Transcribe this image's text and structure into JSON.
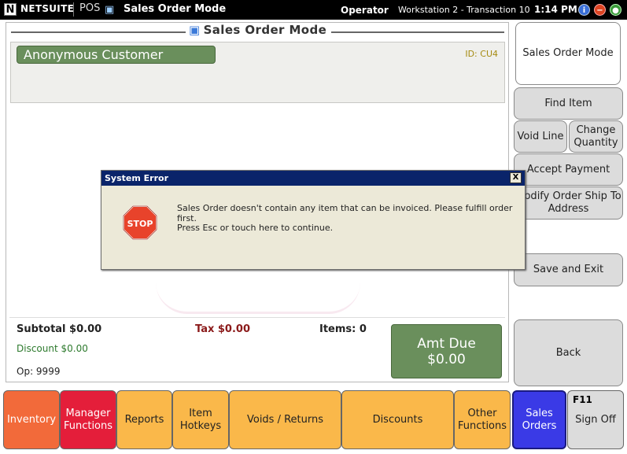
{
  "titlebar": {
    "logo_letter": "N",
    "brand": "NETSUITE",
    "product": "POS",
    "mode": "Sales Order Mode",
    "operator": "Operator",
    "workstation": "Workstation 2 - Transaction 10",
    "time": "1:14 PM",
    "icons": [
      "info-icon",
      "close-icon",
      "globe-icon"
    ]
  },
  "main": {
    "heading": "Sales Order Mode",
    "customer": {
      "name": "Anonymous Customer",
      "id": "ID: CU4"
    },
    "totals": {
      "subtotal": "Subtotal $0.00",
      "tax": "Tax $0.00",
      "items": "Items: 0",
      "discount": "Discount $0.00",
      "op": "Op: 9999",
      "amt_due_label": "Amt Due",
      "amt_due_value": "$0.00"
    }
  },
  "side": {
    "sales_order_mode": "Sales Order Mode",
    "find_item": "Find Item",
    "void_line": "Void Line",
    "change_quantity": "Change Quantity",
    "accept_payment": "Accept Payment",
    "modify_ship": "Modify Order Ship To Address",
    "save_exit": "Save and Exit",
    "back": "Back"
  },
  "functions": {
    "inventory": "Inventory",
    "manager": "Manager Functions",
    "reports": "Reports",
    "hotkeys": "Item Hotkeys",
    "voids": "Voids / Returns",
    "discounts": "Discounts",
    "other": "Other Functions",
    "sales_orders": "Sales Orders",
    "signoff_key": "F11",
    "signoff": "Sign Off"
  },
  "dialog": {
    "title": "System Error",
    "close": "X",
    "stop_text": "STOP",
    "message": "Sales Order doesn't contain any item that can be invoiced. Please fulfill order first.",
    "hint": "Press Esc or touch here to continue."
  },
  "colors": {
    "title_bg": "#000000",
    "customer_green": "#6a8f5c",
    "orange": "#fab84a",
    "inventory": "#f26a3a",
    "manager": "#e41e3a",
    "sales_orders": "#3a3ae6",
    "dialog_title": "#0a246a",
    "stop_red": "#e8432b"
  }
}
